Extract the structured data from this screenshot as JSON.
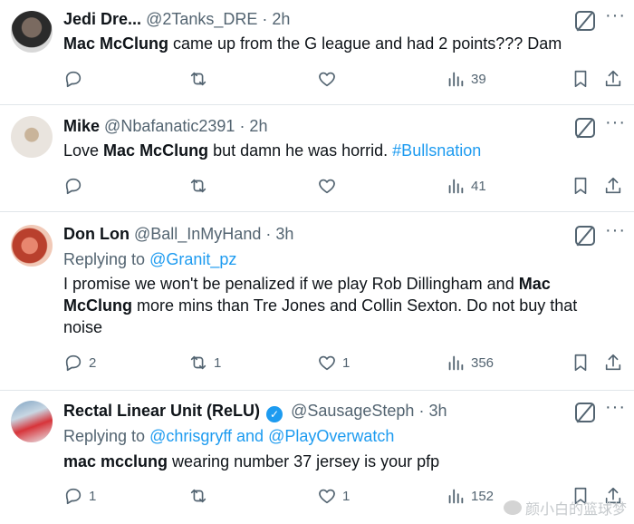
{
  "tweets": [
    {
      "name": "Jedi Dre...",
      "handle": "@2Tanks_DRE",
      "time": "· 2h",
      "verified": false,
      "body_parts": [
        {
          "text": "Mac McClung",
          "bold": true
        },
        {
          "text": " came up from the G league and had 2 points??? Dam"
        }
      ],
      "replies": "",
      "retweets": "",
      "likes": "",
      "views": "39"
    },
    {
      "name": "Mike",
      "handle": "@Nbafanatic2391",
      "time": "· 2h",
      "verified": false,
      "body_parts": [
        {
          "text": "Love "
        },
        {
          "text": "Mac McClung",
          "bold": true
        },
        {
          "text": " but damn he was horrid. "
        },
        {
          "text": "#Bullsnation",
          "link": true
        }
      ],
      "replies": "",
      "retweets": "",
      "likes": "",
      "views": "41"
    },
    {
      "name": "Don Lon",
      "handle": "@Ball_InMyHand",
      "time": "· 3h",
      "verified": false,
      "replying_label": "Replying to",
      "replying_to": "@Granit_pz",
      "body_parts": [
        {
          "text": "I promise we won't be penalized if we play Rob Dillingham and "
        },
        {
          "text": "Mac McClung",
          "bold": true
        },
        {
          "text": " more mins than Tre Jones and Collin Sexton.  Do not buy that noise"
        }
      ],
      "replies": "2",
      "retweets": "1",
      "likes": "1",
      "views": "356"
    },
    {
      "name": "Rectal Linear Unit (ReLU)",
      "handle": "@SausageSteph",
      "time": "· 3h",
      "verified": true,
      "replying_label": "Replying to",
      "replying_to": "@chrisgryff and @PlayOverwatch",
      "body_parts": [
        {
          "text": "mac mcclung",
          "bold": true
        },
        {
          "text": " wearing number 37 jersey is your pfp"
        }
      ],
      "replies": "1",
      "retweets": "",
      "likes": "1",
      "views": "152"
    }
  ],
  "watermark": "颜小白的篮球梦",
  "more_glyph": "···",
  "verified_glyph": "✓",
  "icons": {
    "reply": "reply-icon",
    "retweet": "retweet-icon",
    "like": "heart-icon",
    "views": "views-icon",
    "bookmark": "bookmark-icon",
    "share": "share-icon",
    "grok": "grok-icon"
  },
  "colors": {
    "link": "#1d9bf0",
    "secondary": "#536471",
    "text": "#0f1419"
  }
}
